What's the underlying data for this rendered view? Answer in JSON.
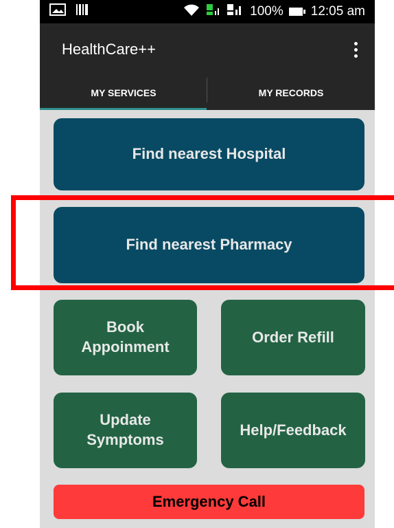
{
  "status_bar": {
    "time": "12:05 am",
    "battery": "100%",
    "icons": [
      "image-icon",
      "barcode-icon",
      "wifi-icon",
      "sim1-signal-icon",
      "sim2-signal-icon",
      "battery-icon"
    ]
  },
  "app_bar": {
    "title": "HealthCare++",
    "overflow_icon": "more-vert-icon"
  },
  "tabs": {
    "items": [
      {
        "label": "MY SERVICES",
        "selected": true
      },
      {
        "label": "MY RECORDS",
        "selected": false
      }
    ],
    "indicator_color": "#2f8f8d"
  },
  "buttons": {
    "hospital": "Find nearest Hospital",
    "pharmacy": "Find nearest Pharmacy",
    "book": "Book\nAppoinment",
    "refill": "Order Refill",
    "symptoms": "Update\nSymptoms",
    "help": "Help/Feedback",
    "emergency": "Emergency Call"
  },
  "colors": {
    "primary_blue": "#084a63",
    "primary_green": "#236344",
    "emergency_red": "#ff3a3a",
    "highlight_red": "#ff0000",
    "app_bar": "#262626"
  }
}
